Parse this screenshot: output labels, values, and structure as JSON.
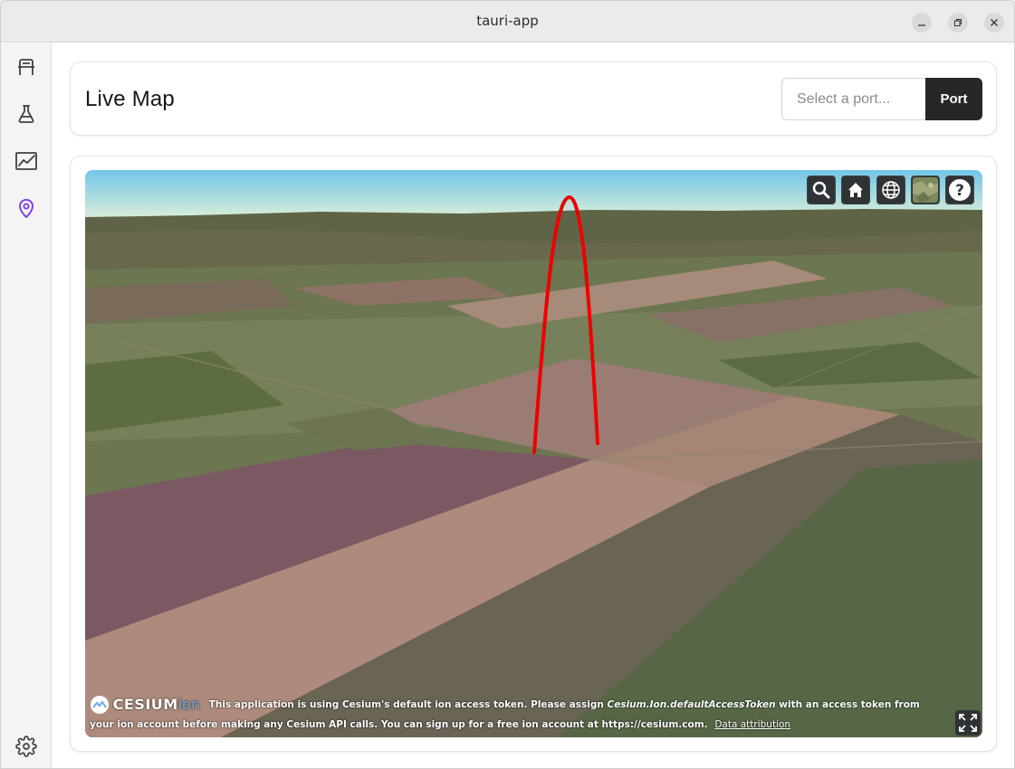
{
  "window": {
    "title": "tauri-app"
  },
  "sidebar": {
    "items": [
      {
        "name": "hardware",
        "icon": "desk-icon"
      },
      {
        "name": "lab",
        "icon": "flask-icon"
      },
      {
        "name": "charts",
        "icon": "line-chart-icon"
      },
      {
        "name": "map",
        "icon": "map-pin-icon",
        "active": true
      }
    ],
    "settings_icon": "gear-icon",
    "accent": "#7c3aed"
  },
  "header": {
    "title": "Live Map",
    "port_placeholder": "Select a port...",
    "port_button": "Port"
  },
  "map": {
    "toolbar": [
      "search-icon",
      "home-icon",
      "globe-icon",
      "imagery-icon",
      "help-icon"
    ],
    "logo_text": "CESIUM",
    "logo_ion": "ion",
    "credit_text": "This application is using Cesium's default ion access token. Please assign ",
    "credit_code": "Cesium.Ion.defaultAccessToken",
    "credit_text2": " with an access token from your ion account before making any Cesium API calls. You can sign up for a free ion account at https://cesium.com.",
    "credit_link": "Data attribution",
    "trajectory_color": "#ee0000"
  }
}
